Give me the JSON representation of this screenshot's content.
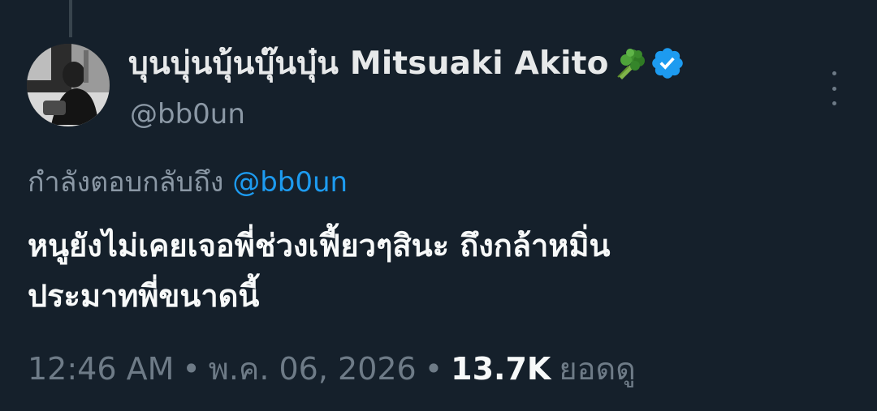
{
  "tweet": {
    "author": {
      "display_name": "บุนบุ่นบุ้นบุ๊นบุ๋น Mitsuaki Akito",
      "name_emoji": "broccoli-icon",
      "verified": true,
      "handle": "@bb0un"
    },
    "reply_context": {
      "prefix": "กำลังตอบกลับถึง",
      "mention": "@bb0un"
    },
    "text_lines": [
      "หนูยังไม่เคยเจอพี่ช่วงเฟี้ยวๆสินะ ถึงกล้าหมิ่น",
      "ประมาทพี่ขนาดนี้"
    ],
    "meta": {
      "time": "12:46 AM",
      "separator": "•",
      "date": "พ.ค. 06, 2026",
      "views_count": "13.7K",
      "views_label": "ยอดดู"
    }
  },
  "colors": {
    "background": "#15202b",
    "text_primary": "#f7f9f9",
    "text_secondary": "#8b98a5",
    "accent": "#1d9bf0",
    "verified_badge": "#1d9bf0"
  }
}
